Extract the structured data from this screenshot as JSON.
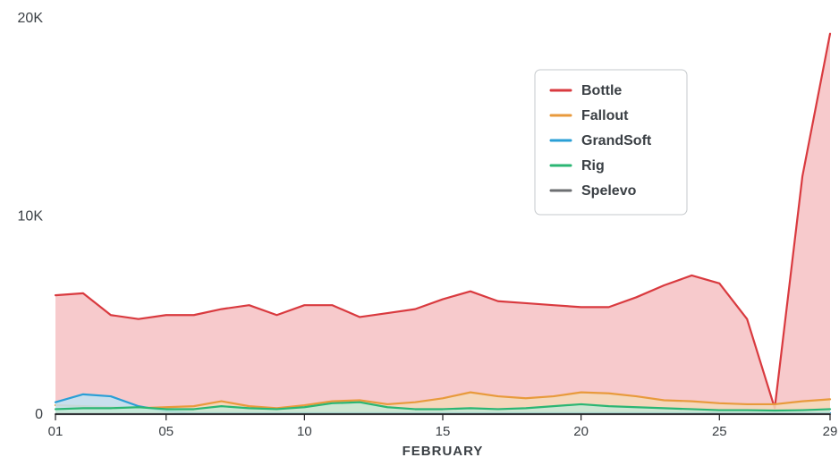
{
  "chart_data": {
    "type": "area",
    "x": [
      1,
      2,
      3,
      4,
      5,
      6,
      7,
      8,
      9,
      10,
      11,
      12,
      13,
      14,
      15,
      16,
      17,
      18,
      19,
      20,
      21,
      22,
      23,
      24,
      25,
      26,
      27,
      28,
      29
    ],
    "x_month_label": "FEBRUARY",
    "x_tick_labels": [
      "01",
      "05",
      "10",
      "15",
      "20",
      "25",
      "29"
    ],
    "x_tick_values": [
      1,
      5,
      10,
      15,
      20,
      25,
      29
    ],
    "y_ticks": [
      0,
      10000,
      20000
    ],
    "y_tick_labels": [
      "0",
      "10K",
      "20K"
    ],
    "xlim": [
      1,
      29
    ],
    "ylim": [
      0,
      20000
    ],
    "series": [
      {
        "name": "Bottle",
        "color": "#d93a3f",
        "fill": "#f6c4c7",
        "values": [
          6000,
          6100,
          5000,
          4800,
          5000,
          5000,
          5300,
          5500,
          5000,
          5500,
          5500,
          4900,
          5100,
          5300,
          5800,
          6200,
          5700,
          5600,
          5500,
          5400,
          5400,
          5900,
          6500,
          7000,
          6600,
          4800,
          300,
          12000,
          19200
        ]
      },
      {
        "name": "Fallout",
        "color": "#e89a3c",
        "fill": "#f5d9b8",
        "values": [
          450,
          400,
          350,
          300,
          350,
          400,
          650,
          400,
          300,
          450,
          650,
          700,
          500,
          600,
          800,
          1100,
          900,
          800,
          900,
          1100,
          1050,
          900,
          700,
          650,
          550,
          500,
          500,
          650,
          750
        ]
      },
      {
        "name": "GrandSoft",
        "color": "#2a9fd6",
        "fill": "#bfe3f2",
        "values": [
          600,
          1000,
          900,
          400,
          150,
          50,
          50,
          50,
          50,
          50,
          50,
          50,
          50,
          50,
          50,
          50,
          50,
          50,
          50,
          50,
          50,
          50,
          50,
          50,
          50,
          50,
          50,
          50,
          50
        ]
      },
      {
        "name": "Rig",
        "color": "#2bb673",
        "fill": "#c4e9d6",
        "values": [
          250,
          300,
          300,
          350,
          250,
          250,
          400,
          300,
          250,
          350,
          550,
          600,
          350,
          250,
          250,
          300,
          250,
          300,
          400,
          500,
          400,
          350,
          300,
          250,
          200,
          200,
          180,
          200,
          250
        ]
      },
      {
        "name": "Spelevo",
        "color": "#6d6f72",
        "fill": "#d4d5d7",
        "values": [
          0,
          0,
          0,
          0,
          0,
          0,
          0,
          0,
          0,
          0,
          0,
          0,
          0,
          0,
          0,
          0,
          0,
          0,
          0,
          0,
          0,
          0,
          0,
          0,
          0,
          0,
          0,
          0,
          0
        ]
      }
    ],
    "legend": {
      "position": "top-right",
      "entries": [
        "Bottle",
        "Fallout",
        "GrandSoft",
        "Rig",
        "Spelevo"
      ]
    }
  }
}
